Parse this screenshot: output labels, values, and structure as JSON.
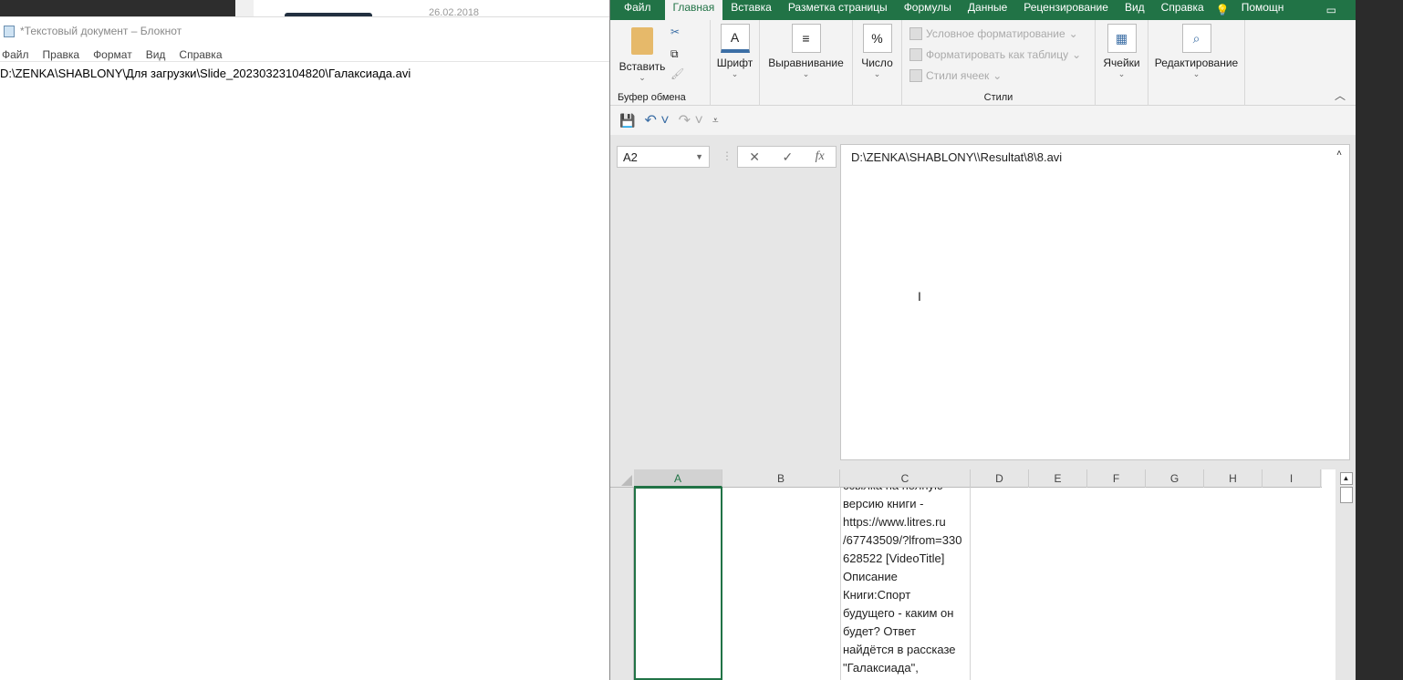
{
  "background": {
    "date": "26.02.2018"
  },
  "notepad": {
    "title": "*Текстовый документ – Блокнот",
    "menu": [
      "Файл",
      "Правка",
      "Формат",
      "Вид",
      "Справка"
    ],
    "content": "D:\\ZENKA\\SHABLONY\\Для загрузки\\Slide_20230323104820\\Галаксиада.avi"
  },
  "excel": {
    "tabs": [
      "Файл",
      "Главная",
      "Вставка",
      "Разметка страницы",
      "Формулы",
      "Данные",
      "Рецензирование",
      "Вид",
      "Справка",
      "Помощн"
    ],
    "active_tab": "Главная",
    "ribbon": {
      "paste": "Вставить",
      "clipboard": "Буфер обмена",
      "font": "Шрифт",
      "alignment": "Выравнивание",
      "number": "Число",
      "styles": [
        "Условное форматирование",
        "Форматировать как таблицу",
        "Стили ячеек"
      ],
      "styles_group": "Стили",
      "cells": "Ячейки",
      "editing": "Редактирование"
    },
    "name_box": "A2",
    "formula": "D:\\ZENKA\\SHABLONY\\\\Resultat\\8\\8.avi",
    "columns": [
      "A",
      "B",
      "C",
      "D",
      "E",
      "F",
      "G",
      "H",
      "I"
    ],
    "cell_c_lines": [
      "ссылка на полную",
      "версию книги -",
      "https://www.litres.ru",
      "/67743509/?lfrom=330",
      "628522 [VideoTitle]",
      "Описание",
      "Книги:Спорт",
      "будущего - каким он",
      "будет? Ответ",
      "найдётся в рассказе",
      "\"Галаксиада\","
    ]
  },
  "colors": {
    "excel_green": "#217346"
  }
}
